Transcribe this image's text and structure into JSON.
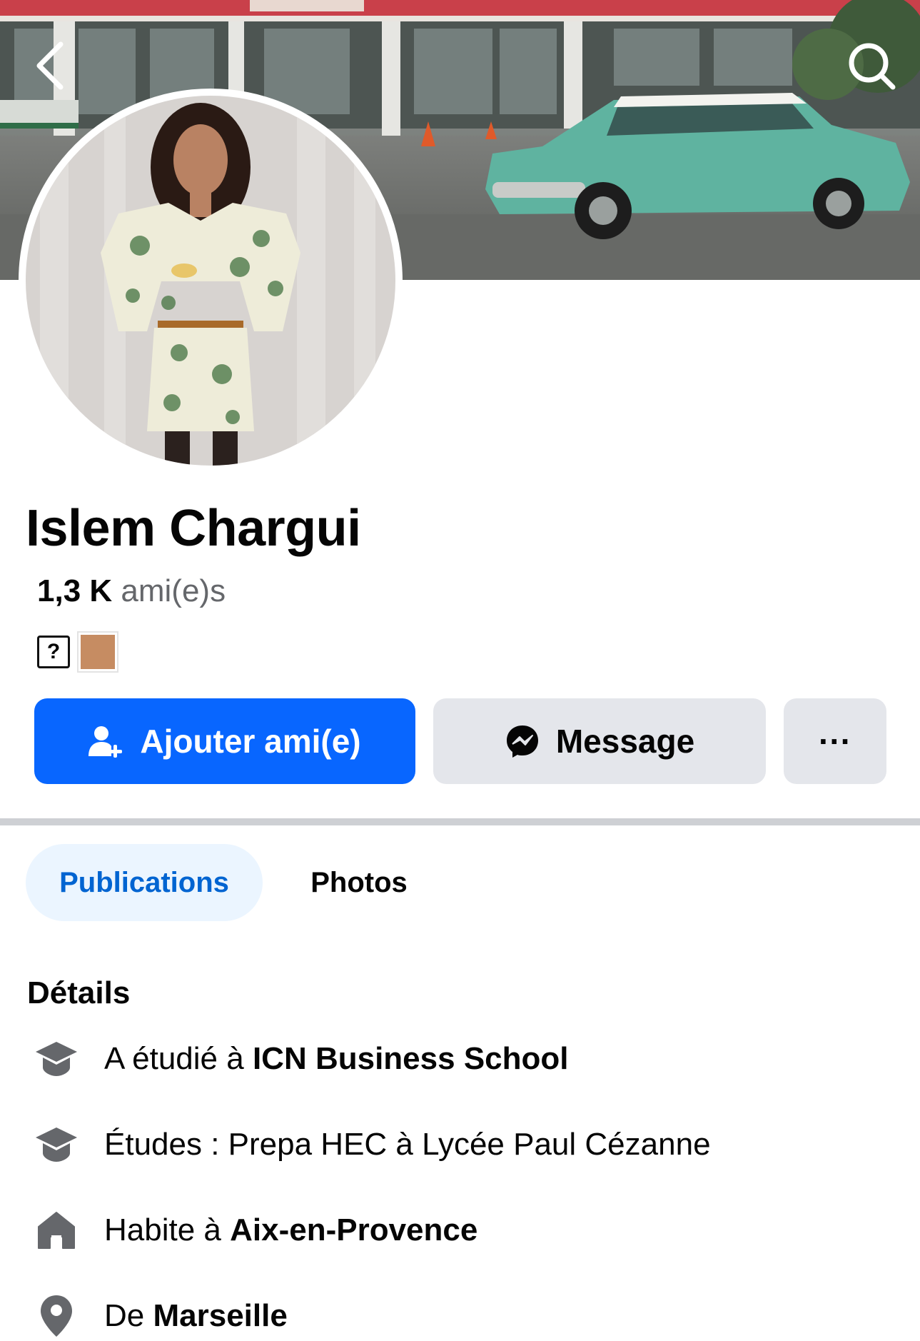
{
  "header": {
    "back_icon": "chevron-left-icon",
    "search_icon": "search-icon"
  },
  "profile": {
    "name": "Islem Chargui",
    "friends_count": "1,3 K",
    "friends_label": "ami(e)s",
    "badge_symbol": "?",
    "badge_color": "#c68c62"
  },
  "actions": {
    "add_friend": "Ajouter ami(e)",
    "message": "Message",
    "more": "···"
  },
  "tabs": {
    "publications": "Publications",
    "photos": "Photos"
  },
  "details": {
    "title": "Détails",
    "items": [
      {
        "icon": "graduation-cap-icon",
        "prefix": "A étudié à ",
        "value": "ICN Business School"
      },
      {
        "icon": "graduation-cap-icon",
        "prefix": "Études : Prepa HEC à Lycée Paul Cézanne",
        "value": ""
      },
      {
        "icon": "home-icon",
        "prefix": "Habite à ",
        "value": "Aix-en-Provence"
      },
      {
        "icon": "location-pin-icon",
        "prefix": "De ",
        "value": "Marseille"
      }
    ]
  },
  "colors": {
    "primary": "#0866ff",
    "secondary_button": "#e4e6eb",
    "active_tab_bg": "#ebf5ff",
    "active_tab_text": "#0064d1",
    "muted_text": "#65676b"
  }
}
